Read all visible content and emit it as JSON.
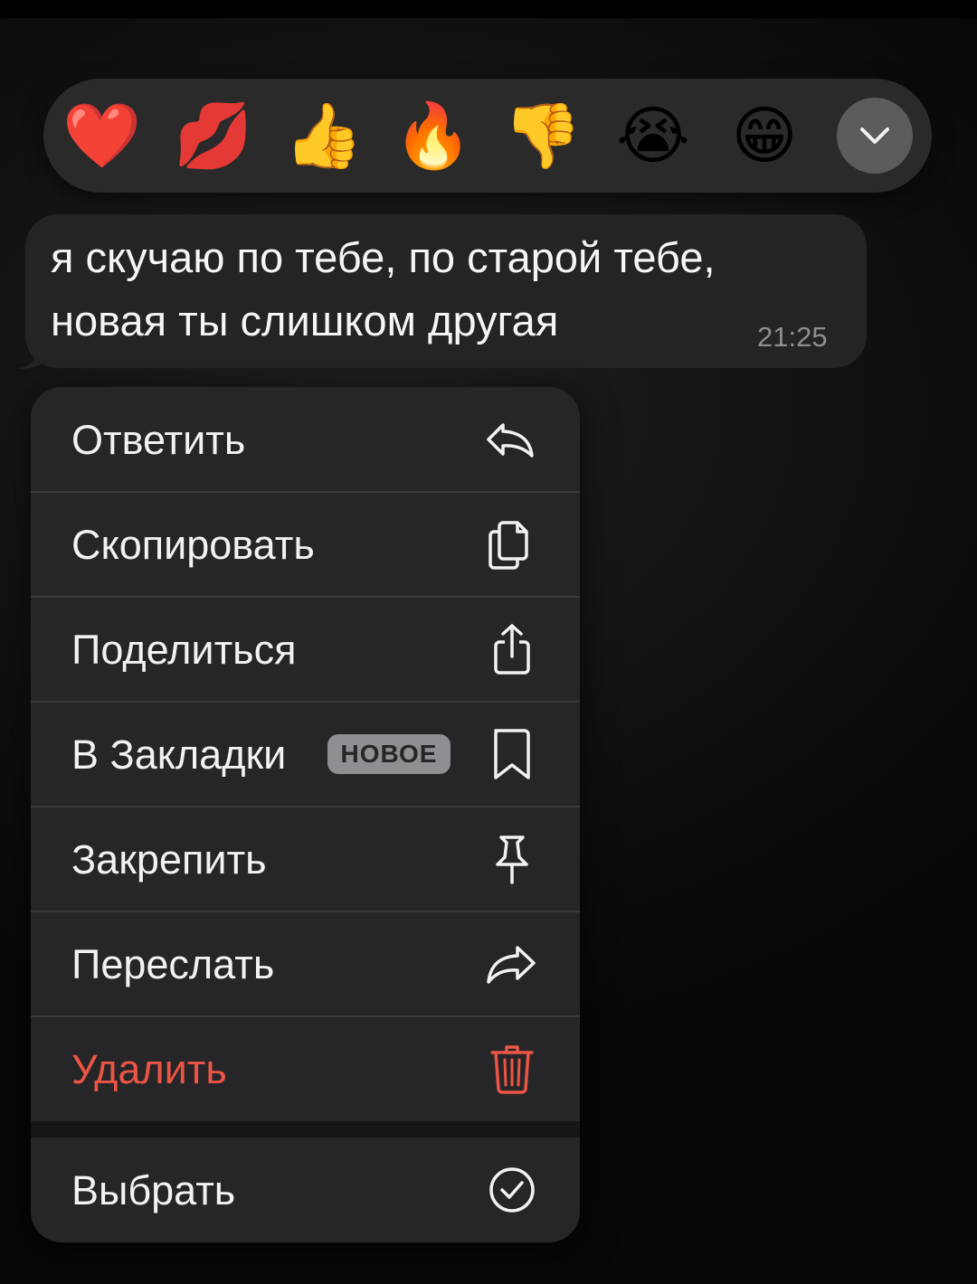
{
  "reactions": [
    {
      "emoji": "❤️",
      "name": "red-heart"
    },
    {
      "emoji": "💋",
      "name": "kiss-mark"
    },
    {
      "emoji": "👍",
      "name": "thumbs-up"
    },
    {
      "emoji": "🔥",
      "name": "fire"
    },
    {
      "emoji": "👎",
      "name": "thumbs-down"
    },
    {
      "emoji": "😭",
      "name": "loudly-crying-face"
    },
    {
      "emoji": "😁",
      "name": "beaming-face"
    }
  ],
  "expand_icon": "chevron-down-icon",
  "message": {
    "line1": "я скучаю по тебе, по старой тебе,",
    "line2": "новая ты слишком другая",
    "time": "21:25"
  },
  "menu": {
    "reply": "Ответить",
    "copy": "Скопировать",
    "share": "Поделиться",
    "bookmark": "В Закладки",
    "bookmark_badge": "НОВОЕ",
    "pin": "Закрепить",
    "forward": "Переслать",
    "delete": "Удалить",
    "select": "Выбрать"
  },
  "colors": {
    "danger": "#eb5545",
    "menu_bg": "#262628",
    "bubble_bg": "#242425"
  }
}
